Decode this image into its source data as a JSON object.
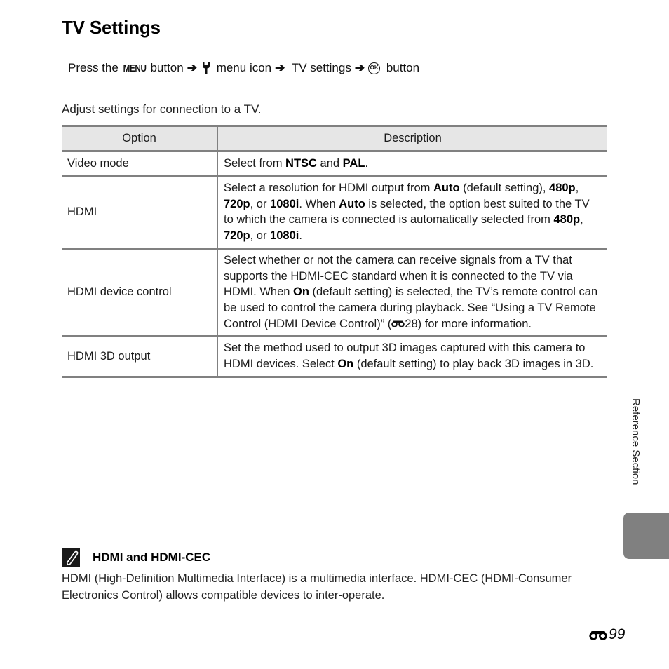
{
  "page": {
    "title": "TV Settings",
    "nav_path": {
      "press_the": "Press the ",
      "menu_label": "MENU",
      "button_1": " button",
      "arrow": "➔",
      "menu_icon": " menu icon",
      "tv_settings": " TV settings",
      "ok_label": "OK",
      "button_2": " button"
    },
    "intro": "Adjust settings for connection to a TV.",
    "side_tab_label": "Reference Section",
    "page_number": "99"
  },
  "table": {
    "headers": {
      "option": "Option",
      "description": "Description"
    },
    "rows": [
      {
        "option": "Video mode",
        "desc": {
          "t1": "Select from ",
          "b1": "NTSC",
          "t2": " and ",
          "b2": "PAL",
          "t3": "."
        }
      },
      {
        "option": "HDMI",
        "desc": {
          "t1": "Select a resolution for HDMI output from ",
          "b1": "Auto",
          "t2": " (default setting), ",
          "b2": "480p",
          "t3": ", ",
          "b3": "720p",
          "t4": ", or ",
          "b4": "1080i",
          "t5": ". When ",
          "b5": "Auto",
          "t6": " is selected, the option best suited to the TV to which the camera is connected is automatically selected from ",
          "b6": "480p",
          "t7": ", ",
          "b7": "720p",
          "t8": ", or ",
          "b8": "1080i",
          "t9": "."
        }
      },
      {
        "option": "HDMI device control",
        "desc": {
          "t1": "Select whether or not the camera can receive signals from a TV that supports the HDMI-CEC standard when it is connected to the TV via HDMI. When ",
          "b1": "On",
          "t2": " (default setting) is selected, the TV’s remote control can be used to control the camera during playback. See “Using a TV Remote Control (HDMI Device Control)” (",
          "ref": "28",
          "t3": ") for more information."
        }
      },
      {
        "option": "HDMI 3D output",
        "desc": {
          "t1": "Set the method used to output 3D images captured with this camera to HDMI devices. Select ",
          "b1": "On",
          "t2": " (default setting) to play back 3D images in 3D."
        }
      }
    ]
  },
  "note": {
    "title": "HDMI and HDMI-CEC",
    "body": "HDMI (High-Definition Multimedia Interface) is a multimedia interface. HDMI-CEC (HDMI-Consumer Electronics Control) allows compatible devices to inter-operate."
  }
}
